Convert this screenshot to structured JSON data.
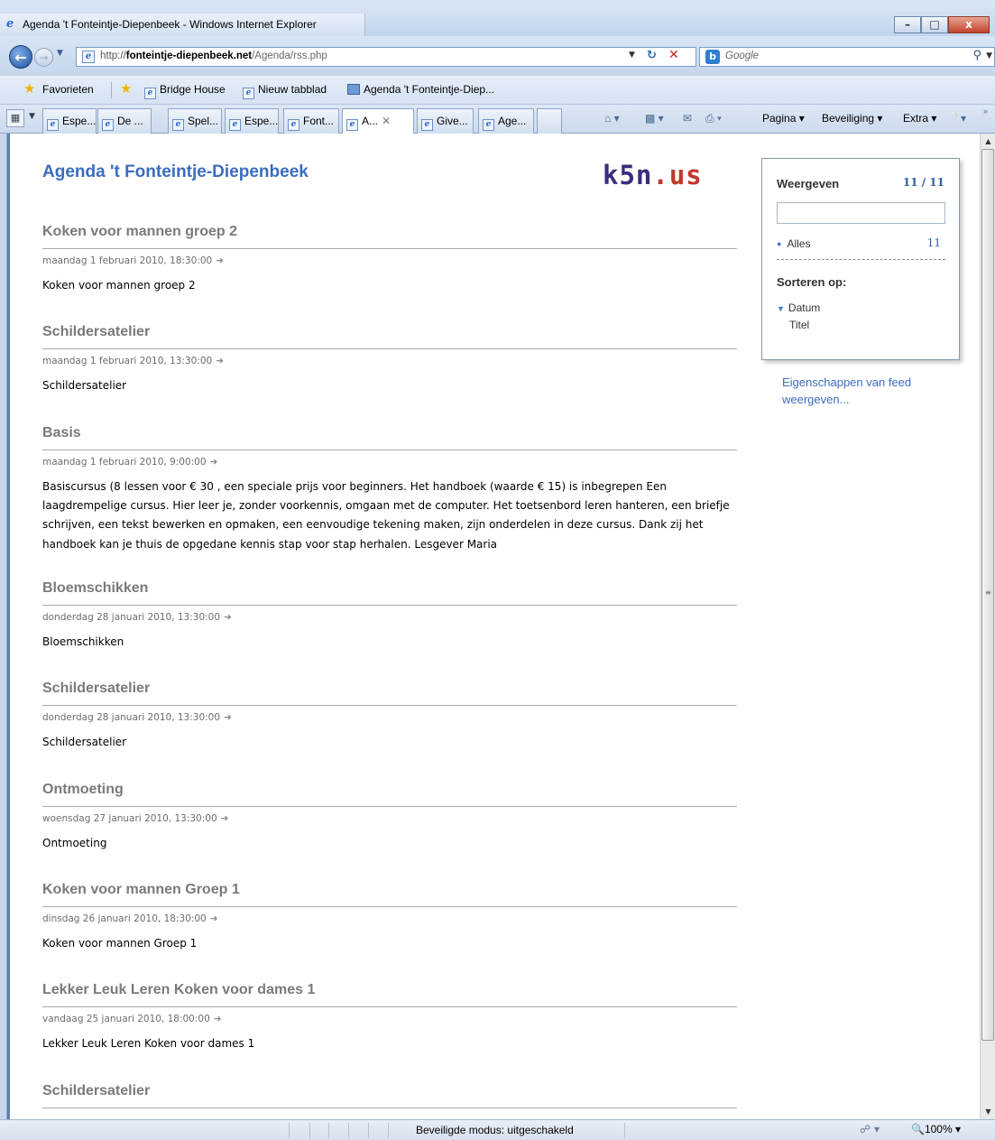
{
  "window": {
    "title": "Agenda 't Fonteintje-Diepenbeek - Windows Internet Explorer",
    "minimize": "–",
    "maximize": "□",
    "close": "x"
  },
  "address": {
    "url_prefix": "http://",
    "url_domain": "fonteintje-diepenbeek.net",
    "url_path": "/Agenda/rss.php",
    "search_placeholder": "Google"
  },
  "favorites": {
    "label": "Favorieten",
    "items": [
      "Bridge House",
      "Nieuw tabblad",
      "Agenda 't Fonteintje-Diep..."
    ]
  },
  "tabs": [
    {
      "label": "Espe..."
    },
    {
      "label": "De ..."
    },
    {
      "label": "Spel..."
    },
    {
      "label": "Espe..."
    },
    {
      "label": "Font..."
    },
    {
      "label": "A...",
      "active": true
    },
    {
      "label": "Give..."
    },
    {
      "label": "Age..."
    }
  ],
  "commands": {
    "page": "Pagina",
    "security": "Beveiliging",
    "extra": "Extra"
  },
  "page": {
    "title": "Agenda 't Fonteintje-Diepenbeek",
    "logo_part1": "k5n",
    "logo_part2": ".us"
  },
  "entries": [
    {
      "title": "Koken voor mannen groep 2",
      "date": "maandag 1 februari 2010, 18:30:00",
      "desc": "Koken voor mannen groep 2"
    },
    {
      "title": "Schildersatelier",
      "date": "maandag 1 februari 2010, 13:30:00",
      "desc": "Schildersatelier"
    },
    {
      "title": "Basis",
      "date": "maandag 1 februari 2010, 9:00:00",
      "desc": "Basiscursus (8 lessen voor € 30 , een speciale prijs voor beginners. Het handboek (waarde € 15) is inbegrepen Een laagdrempelige cursus. Hier leer je, zonder voorkennis, omgaan met de computer. Het toetsenbord leren hanteren, een briefje schrijven, een tekst bewerken en opmaken, een eenvoudige tekening maken, zijn onderdelen in deze cursus. Dank zij het handboek kan je thuis de opgedane kennis stap voor stap herhalen. Lesgever Maria"
    },
    {
      "title": "Bloemschikken",
      "date": "donderdag 28 januari 2010, 13:30:00",
      "desc": "Bloemschikken"
    },
    {
      "title": "Schildersatelier",
      "date": "donderdag 28 januari 2010, 13:30:00",
      "desc": "Schildersatelier"
    },
    {
      "title": "Ontmoeting",
      "date": "woensdag 27 januari 2010, 13:30:00",
      "desc": "Ontmoeting"
    },
    {
      "title": "Koken voor mannen Groep 1",
      "date": "dinsdag 26 januari 2010, 18:30:00",
      "desc": "Koken voor mannen Groep 1"
    },
    {
      "title": "Lekker Leuk Leren Koken voor dames 1",
      "date": "vandaag 25 januari 2010, 18:00:00",
      "desc": "Lekker Leuk Leren Koken voor dames 1"
    },
    {
      "title": "Schildersatelier",
      "date": "",
      "desc": ""
    }
  ],
  "sidebar": {
    "heading": "Weergeven",
    "count": "11 / 11",
    "all_label": "Alles",
    "all_count": "11",
    "sort_heading": "Sorteren op:",
    "sort_date": "Datum",
    "sort_title": "Titel",
    "feed_props": "Eigenschappen van feed weergeven..."
  },
  "status": {
    "mode": "Beveiligde modus: uitgeschakeld",
    "zoom": "100%"
  },
  "colors": {
    "link_blue": "#3b6cc0",
    "entry_title_gray": "#7a7a7a",
    "logo_purple": "#3b2c7e",
    "logo_red": "#c0392b"
  }
}
